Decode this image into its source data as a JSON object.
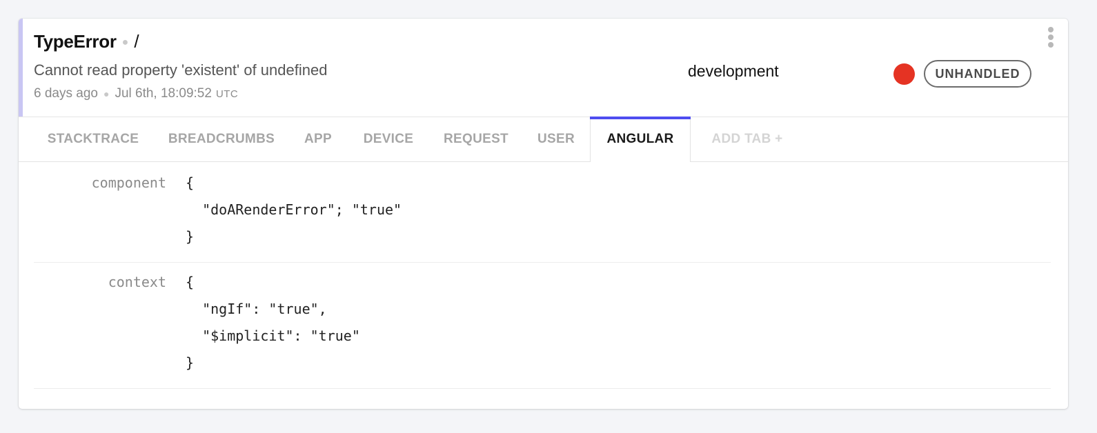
{
  "header": {
    "error_class": "TypeError",
    "context": "/",
    "message": "Cannot read property 'existent' of undefined",
    "relative_time": "6 days ago",
    "absolute_time": "Jul 6th, 18:09:52",
    "timezone": "UTC",
    "release_stage": "development",
    "severity_color": "#e53323",
    "handled_state": "UNHANDLED",
    "menu_icon": "kebab-menu-icon",
    "accent_color": "#c9c6f3"
  },
  "tabs": {
    "items": [
      "STACKTRACE",
      "BREADCRUMBS",
      "APP",
      "DEVICE",
      "REQUEST",
      "USER",
      "ANGULAR"
    ],
    "active": "ANGULAR",
    "add_label": "ADD TAB +",
    "active_color": "#4f4df0"
  },
  "angular": {
    "component": {
      "label": "component",
      "lines": [
        "{",
        "  \"doARenderError\"; \"true\"",
        "}"
      ]
    },
    "context": {
      "label": "context",
      "lines": [
        "{",
        "  \"ngIf\": \"true\",",
        "  \"$implicit\": \"true\"",
        "}"
      ]
    }
  }
}
